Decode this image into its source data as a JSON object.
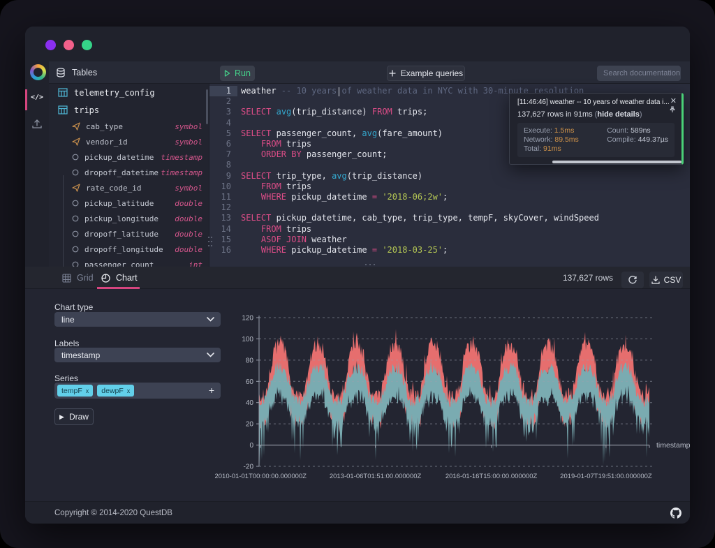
{
  "titlebar": {
    "dot_colors": [
      "#8a2ff0",
      "#f2608a",
      "#35d488"
    ]
  },
  "navbar": {
    "tables_label": "Tables",
    "run_label": "Run",
    "example_queries_label": "Example queries",
    "search_placeholder": "Search documentation"
  },
  "rail": {
    "code_icon": "</>"
  },
  "tables_panel": {
    "tables": [
      {
        "name": "telemetry_config",
        "columns": []
      },
      {
        "name": "trips",
        "columns": [
          {
            "name": "cab_type",
            "type": "symbol"
          },
          {
            "name": "vendor_id",
            "type": "symbol"
          },
          {
            "name": "pickup_datetime",
            "type": "timestamp"
          },
          {
            "name": "dropoff_datetime",
            "type": "timestamp"
          },
          {
            "name": "rate_code_id",
            "type": "symbol"
          },
          {
            "name": "pickup_latitude",
            "type": "double"
          },
          {
            "name": "pickup_longitude",
            "type": "double"
          },
          {
            "name": "dropoff_latitude",
            "type": "double"
          },
          {
            "name": "dropoff_longitude",
            "type": "double"
          },
          {
            "name": "passenger_count",
            "type": "int"
          }
        ]
      }
    ]
  },
  "editor": {
    "lines": [
      {
        "n": 1,
        "hl": true,
        "tokens": [
          [
            "id",
            "weather"
          ],
          [
            "cm",
            " -- 10 years of weather data in NYC with 30-minute resolution"
          ]
        ]
      },
      {
        "n": 2,
        "tokens": []
      },
      {
        "n": 3,
        "tokens": [
          [
            "kw",
            "SELECT"
          ],
          [
            "pu",
            " "
          ],
          [
            "fn",
            "avg"
          ],
          [
            "pu",
            "(trip_distance) "
          ],
          [
            "kw",
            "FROM"
          ],
          [
            "pu",
            " trips;"
          ]
        ]
      },
      {
        "n": 4,
        "tokens": []
      },
      {
        "n": 5,
        "tokens": [
          [
            "kw",
            "SELECT"
          ],
          [
            "pu",
            " passenger_count, "
          ],
          [
            "fn",
            "avg"
          ],
          [
            "pu",
            "(fare_amount)"
          ]
        ]
      },
      {
        "n": 6,
        "tokens": [
          [
            "pu",
            "    "
          ],
          [
            "kw",
            "FROM"
          ],
          [
            "pu",
            " trips"
          ]
        ]
      },
      {
        "n": 7,
        "tokens": [
          [
            "pu",
            "    "
          ],
          [
            "kw",
            "ORDER BY"
          ],
          [
            "pu",
            " passenger_count;"
          ]
        ]
      },
      {
        "n": 8,
        "tokens": []
      },
      {
        "n": 9,
        "tokens": [
          [
            "kw",
            "SELECT"
          ],
          [
            "pu",
            " trip_type, "
          ],
          [
            "fn",
            "avg"
          ],
          [
            "pu",
            "(trip_distance)"
          ]
        ]
      },
      {
        "n": 10,
        "tokens": [
          [
            "pu",
            "    "
          ],
          [
            "kw",
            "FROM"
          ],
          [
            "pu",
            " trips"
          ]
        ]
      },
      {
        "n": 11,
        "tokens": [
          [
            "pu",
            "    "
          ],
          [
            "kw",
            "WHERE"
          ],
          [
            "pu",
            " pickup_datetime "
          ],
          [
            "kw",
            "="
          ],
          [
            "pu",
            " "
          ],
          [
            "str",
            "'2018-06;2w'"
          ],
          [
            "pu",
            ";"
          ]
        ]
      },
      {
        "n": 12,
        "tokens": []
      },
      {
        "n": 13,
        "tokens": [
          [
            "kw",
            "SELECT"
          ],
          [
            "pu",
            " pickup_datetime, cab_type, trip_type, tempF, skyCover, windSpeed"
          ]
        ]
      },
      {
        "n": 14,
        "tokens": [
          [
            "pu",
            "    "
          ],
          [
            "kw",
            "FROM"
          ],
          [
            "pu",
            " trips"
          ]
        ]
      },
      {
        "n": 15,
        "tokens": [
          [
            "pu",
            "    "
          ],
          [
            "kw",
            "ASOF JOIN"
          ],
          [
            "pu",
            " weather"
          ]
        ]
      },
      {
        "n": 16,
        "tokens": [
          [
            "pu",
            "    "
          ],
          [
            "kw",
            "WHERE"
          ],
          [
            "pu",
            " pickup_datetime "
          ],
          [
            "kw",
            "="
          ],
          [
            "pu",
            " "
          ],
          [
            "str",
            "'2018-03-25'"
          ],
          [
            "pu",
            ";"
          ]
        ]
      }
    ]
  },
  "notification": {
    "title": "[11:46:46] weather -- 10 years of weather data i...",
    "summary_prefix": "137,627 rows in 91ms ",
    "paren_open": "(",
    "details_toggle": "hide details",
    "paren_close": ")",
    "metrics_left": [
      {
        "label": "Execute:",
        "value": "1.5ms"
      },
      {
        "label": "Network:",
        "value": "89.5ms"
      },
      {
        "label": "Total:",
        "value": "91ms"
      }
    ],
    "metrics_right": [
      {
        "label": "Count:",
        "value": "589ns"
      },
      {
        "label": "Compile:",
        "value": "449.37µs"
      }
    ],
    "accent_color": "#4ad077"
  },
  "results_bar": {
    "grid_tab": "Grid",
    "chart_tab": "Chart",
    "row_count": "137,627 rows",
    "csv_label": "CSV"
  },
  "chart_controls": {
    "chart_type_label": "Chart type",
    "chart_type_value": "line",
    "labels_label": "Labels",
    "labels_value": "timestamp",
    "series_label": "Series",
    "series_tags": [
      "tempF",
      "dewpF"
    ],
    "draw_label": "Draw"
  },
  "chart_data": {
    "type": "line",
    "xlabel": "timestamp",
    "x_tick_labels": [
      "2010-01-01T00:00:00.000000Z",
      "2013-01-06T01:51:00.000000Z",
      "2016-01-16T15:00:00.000000Z",
      "2019-01-07T19:51:00.000000Z"
    ],
    "x_tick_fractions": [
      0.004,
      0.298,
      0.595,
      0.889
    ],
    "ylim": [
      -20,
      120
    ],
    "yticks": [
      -20,
      0,
      20,
      40,
      60,
      80,
      100,
      120
    ],
    "x_span_years": 10.17,
    "season_peak_fraction": 0.54,
    "grid_dash_color": "#9aa0ad",
    "axis_color": "#9aa0ad",
    "label_color": "#b6bbc6",
    "series": [
      {
        "name": "tempF",
        "color": "#e66e6e",
        "summer_high": 94,
        "winter_high": 45,
        "band": 24,
        "band_jitter": 10,
        "jitter": 7,
        "spike_chance": 0.1,
        "spike": 12
      },
      {
        "name": "dewpF",
        "color": "#7aabb1",
        "summer_high": 73,
        "winter_high": 41,
        "band": 20,
        "band_jitter": 9,
        "jitter": 6,
        "spike_chance": 0.05,
        "spike": 6,
        "winter_drop": 42,
        "winter_drop_chance": 0.55
      }
    ]
  },
  "footer": {
    "copyright": "Copyright © 2014-2020 QuestDB"
  }
}
